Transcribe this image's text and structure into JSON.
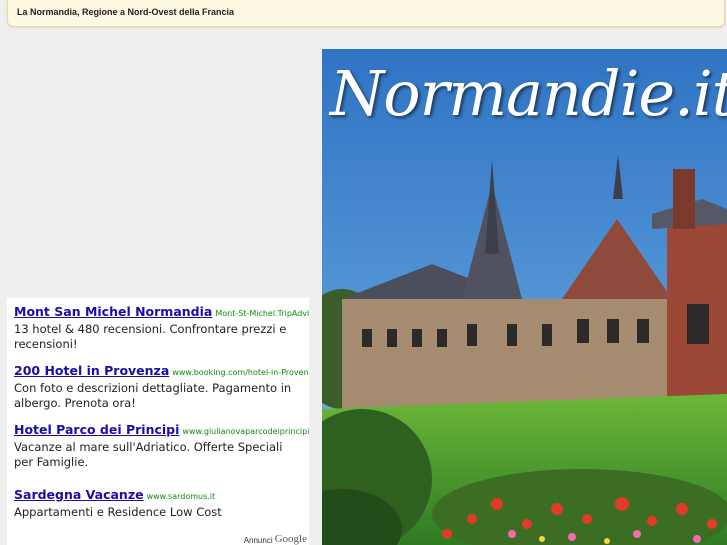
{
  "header": {
    "title": "La Normandia, Regione a Nord-Ovest della Francia"
  },
  "ads": {
    "items": [
      {
        "title": "Mont San Michel Normandia",
        "url": "Mont-St-Michel.TripAdvis…",
        "desc": "13 hotel & 480 recensioni. Confrontare prezzi e recensioni!"
      },
      {
        "title": "200 Hotel in Provenza",
        "url": "www.booking.com/hotel-in-Provence",
        "desc": "Con foto e descrizioni dettagliate. Pagamento in albergo. Prenota ora!"
      },
      {
        "title": "Hotel Parco dei Principi",
        "url": "www.giulianovaparcodeiprincipi.it",
        "desc": "Vacanze al mare sull'Adriatico. Offerte Speciali per Famiglie."
      },
      {
        "title": "Sardegna Vacanze",
        "url": "www.sardomus.it",
        "desc": "Appartamenti e Residence Low Cost"
      }
    ],
    "footer_label": "Annunci",
    "footer_brand": "Google"
  },
  "hero": {
    "title": "Normandie.it"
  },
  "colors": {
    "ad_title": "#1a0dab",
    "ad_url": "#0f8a0f",
    "sky": "#3f86d0",
    "lawn": "#4a9a2c"
  }
}
